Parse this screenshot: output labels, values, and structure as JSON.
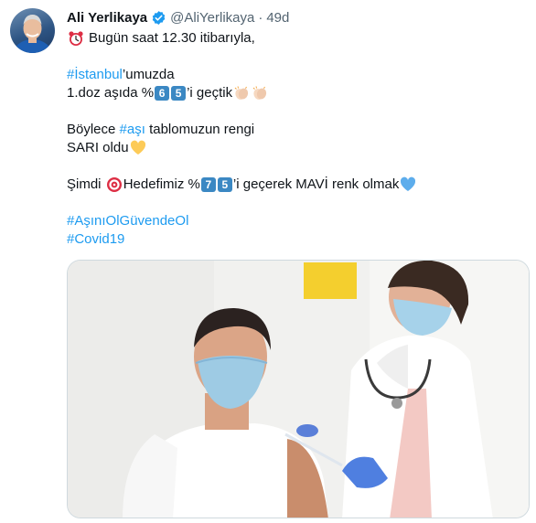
{
  "author": {
    "name": "Ali Yerlikaya",
    "handle": "@AliYerlikaya",
    "separator": "·",
    "time": "49d"
  },
  "tweet": {
    "line1_text": "Bugün saat 12.30 itibarıyla,",
    "line2_hashtag": "#İstanbul",
    "line2_text": "’umuzda",
    "line3_text_a": "1.doz aşıda %",
    "line3_keycap1": "6",
    "line3_keycap2": "5",
    "line3_text_b": "’i geçtik",
    "line4_text_a": "Böylece ",
    "line4_hashtag": "#aşı",
    "line4_text_b": " tablomuzun rengi",
    "line5_text": "SARI oldu",
    "line6_text_a": "Şimdi ",
    "line6_text_b": "Hedefimiz %",
    "line6_keycap1": "7",
    "line6_keycap2": "5",
    "line6_text_c": "’i geçerek MAVİ renk olmak",
    "hashtag1": "#AşınıOlGüvendeOl",
    "hashtag2": "#Covid19"
  },
  "icons": {
    "clock": "alarm-clock-icon",
    "clap": "clapping-hands-icon",
    "yellow_heart": "yellow-heart-icon",
    "target": "direct-hit-icon",
    "blue_heart": "blue-heart-icon",
    "verified": "verified-badge-icon"
  },
  "colors": {
    "hashtag": "#1d9bf0",
    "secondary_text": "#536471",
    "verified": "#1d9bf0",
    "keycap": "#3b88c3"
  }
}
